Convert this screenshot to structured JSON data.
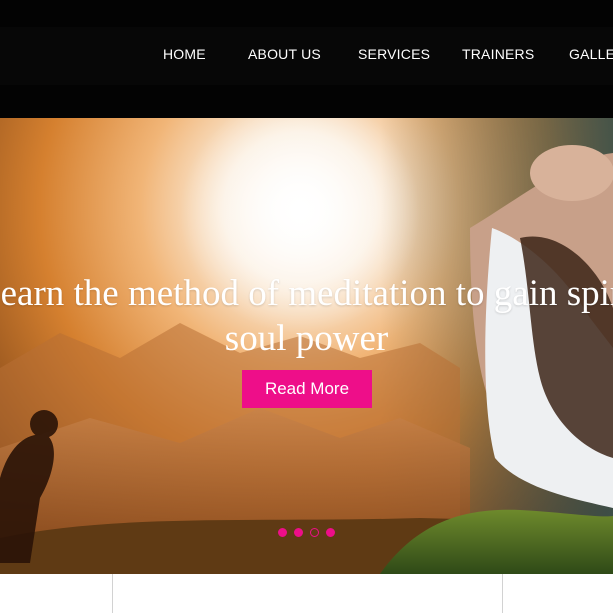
{
  "nav": {
    "items": [
      {
        "label": "HOME"
      },
      {
        "label": "ABOUT US"
      },
      {
        "label": "SERVICES"
      },
      {
        "label": "TRAINERS"
      },
      {
        "label": "GALLERY"
      }
    ]
  },
  "hero": {
    "title": "Learn the method of meditation to gain spiritual and",
    "subtitle": "soul power",
    "button_label": "Read More",
    "slides": 4,
    "active_slide": 3,
    "accent_color": "#ee0e89"
  }
}
